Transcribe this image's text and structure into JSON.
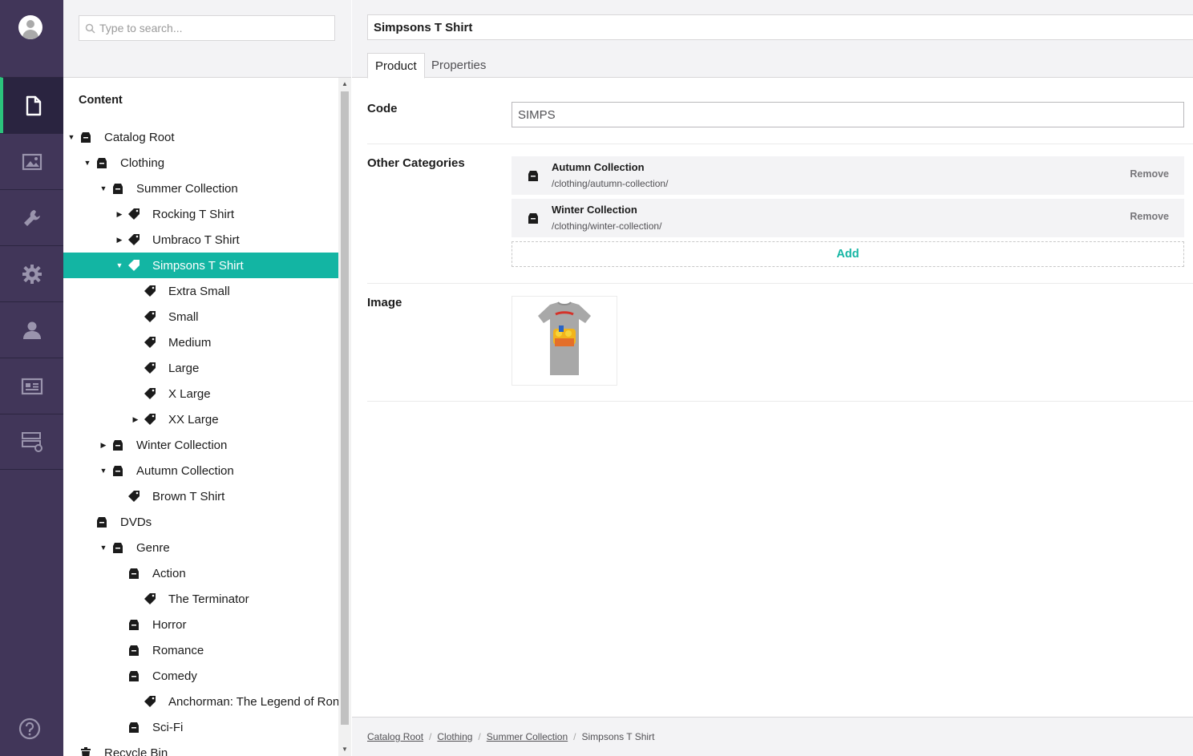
{
  "search": {
    "placeholder": "Type to search..."
  },
  "tree": {
    "title": "Content",
    "items": [
      {
        "label": "Catalog Root",
        "level": 0,
        "caret": "open",
        "icon": "folder-icon"
      },
      {
        "label": "Clothing",
        "level": 1,
        "caret": "open",
        "icon": "folder-icon"
      },
      {
        "label": "Summer Collection",
        "level": 2,
        "caret": "open",
        "icon": "folder-icon"
      },
      {
        "label": "Rocking T Shirt",
        "level": 3,
        "caret": "closed",
        "icon": "tag-icon"
      },
      {
        "label": "Umbraco T Shirt",
        "level": 3,
        "caret": "closed",
        "icon": "tag-icon"
      },
      {
        "label": "Simpsons T Shirt",
        "level": 3,
        "caret": "open",
        "icon": "tag-icon",
        "selected": true
      },
      {
        "label": "Extra Small",
        "level": 4,
        "caret": "none",
        "icon": "tag-icon"
      },
      {
        "label": "Small",
        "level": 4,
        "caret": "none",
        "icon": "tag-icon"
      },
      {
        "label": "Medium",
        "level": 4,
        "caret": "none",
        "icon": "tag-icon"
      },
      {
        "label": "Large",
        "level": 4,
        "caret": "none",
        "icon": "tag-icon"
      },
      {
        "label": "X Large",
        "level": 4,
        "caret": "none",
        "icon": "tag-icon"
      },
      {
        "label": "XX Large",
        "level": 4,
        "caret": "closed",
        "icon": "tag-icon"
      },
      {
        "label": "Winter Collection",
        "level": 2,
        "caret": "closed",
        "icon": "folder-icon"
      },
      {
        "label": "Autumn Collection",
        "level": 2,
        "caret": "open",
        "icon": "folder-icon"
      },
      {
        "label": "Brown T Shirt",
        "level": 3,
        "caret": "none",
        "icon": "tag-icon"
      },
      {
        "label": "DVDs",
        "level": 1,
        "caret": "none",
        "icon": "folder-icon"
      },
      {
        "label": "Genre",
        "level": 2,
        "caret": "open",
        "icon": "folder-icon"
      },
      {
        "label": "Action",
        "level": 3,
        "caret": "none",
        "icon": "folder-icon"
      },
      {
        "label": "The Terminator",
        "level": 4,
        "caret": "none",
        "icon": "tag-icon"
      },
      {
        "label": "Horror",
        "level": 3,
        "caret": "none",
        "icon": "folder-icon"
      },
      {
        "label": "Romance",
        "level": 3,
        "caret": "none",
        "icon": "folder-icon"
      },
      {
        "label": "Comedy",
        "level": 3,
        "caret": "none",
        "icon": "folder-icon"
      },
      {
        "label": "Anchorman: The Legend of Ron",
        "level": 4,
        "caret": "none",
        "icon": "tag-icon"
      },
      {
        "label": "Sci-Fi",
        "level": 3,
        "caret": "none",
        "icon": "folder-icon"
      },
      {
        "label": "Recycle Bin",
        "level": 0,
        "caret": "none",
        "icon": "trash-icon"
      }
    ]
  },
  "editor": {
    "name": "Simpsons T Shirt",
    "tabs": [
      {
        "label": "Product",
        "active": true
      },
      {
        "label": "Properties",
        "active": false
      }
    ],
    "properties": {
      "code_label": "Code",
      "code_value": "SIMPS",
      "categories_label": "Other Categories",
      "categories": [
        {
          "title": "Autumn Collection",
          "path": "/clothing/autumn-collection/",
          "remove": "Remove"
        },
        {
          "title": "Winter Collection",
          "path": "/clothing/winter-collection/",
          "remove": "Remove"
        }
      ],
      "add_label": "Add",
      "image_label": "Image"
    }
  },
  "breadcrumb": {
    "items": [
      "Catalog Root",
      "Clothing",
      "Summer Collection"
    ],
    "current": "Simpsons T Shirt"
  },
  "rail": {
    "sections": [
      "content-icon",
      "media-icon",
      "settings-wrench-icon",
      "settings-gear-icon",
      "members-icon",
      "member-card-icon",
      "forms-icon"
    ],
    "help": "help-icon"
  },
  "colors": {
    "rail_bg": "#413659",
    "accent": "#13b5a3",
    "active_marker": "#2bc37c"
  }
}
